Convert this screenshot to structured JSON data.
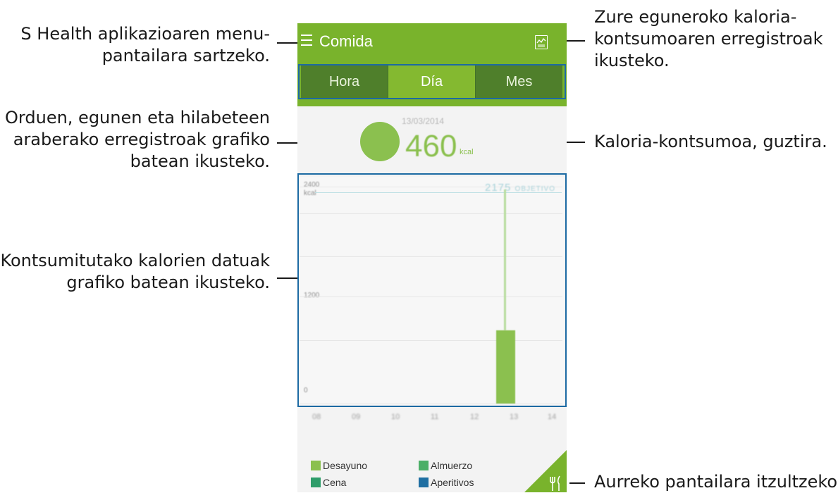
{
  "annotations": {
    "menu": [
      "S Health aplikazioaren menu-",
      "pantailara sartzeko."
    ],
    "periods": [
      "Orduen, egunen eta hilabeteen",
      "araberako erregistroak grafiko",
      "batean ikusteko."
    ],
    "graph": [
      "Kontsumitutako kalorien datuak",
      "grafiko batean ikusteko."
    ],
    "records": [
      "Zure eguneroko kaloria-",
      "kontsumoaren erregistroak",
      "ikusteko."
    ],
    "total": [
      "Kaloria-kontsumoa, guztira."
    ],
    "back": [
      "Aurreko pantailara itzultzeko."
    ]
  },
  "app": {
    "title": "Comida",
    "accent": "#79b32c"
  },
  "tabs": [
    {
      "label": "Hora",
      "active": false
    },
    {
      "label": "Día",
      "active": true
    },
    {
      "label": "Mes",
      "active": false
    }
  ],
  "summary": {
    "date": "13/03/2014",
    "value": "460",
    "unit": "kcal"
  },
  "graph": {
    "y_top": "2400",
    "y_top_unit": "kcal",
    "y_mid": "1200",
    "y_zero": "0",
    "target_value": "2175",
    "target_label": "OBJETIVO",
    "x_labels": [
      "08",
      "09",
      "10",
      "11",
      "12",
      "13",
      "14"
    ]
  },
  "legend": [
    {
      "label": "Desayuno",
      "color": "#8bc04f"
    },
    {
      "label": "Almuerzo",
      "color": "#4caf67"
    },
    {
      "label": "Cena",
      "color": "#2e9d6a"
    },
    {
      "label": "Aperitivos",
      "color": "#1f6fa2"
    }
  ],
  "icons": {
    "menu": "hamburger-icon",
    "records": "chart-icon",
    "back": "fork-knife-icon"
  }
}
